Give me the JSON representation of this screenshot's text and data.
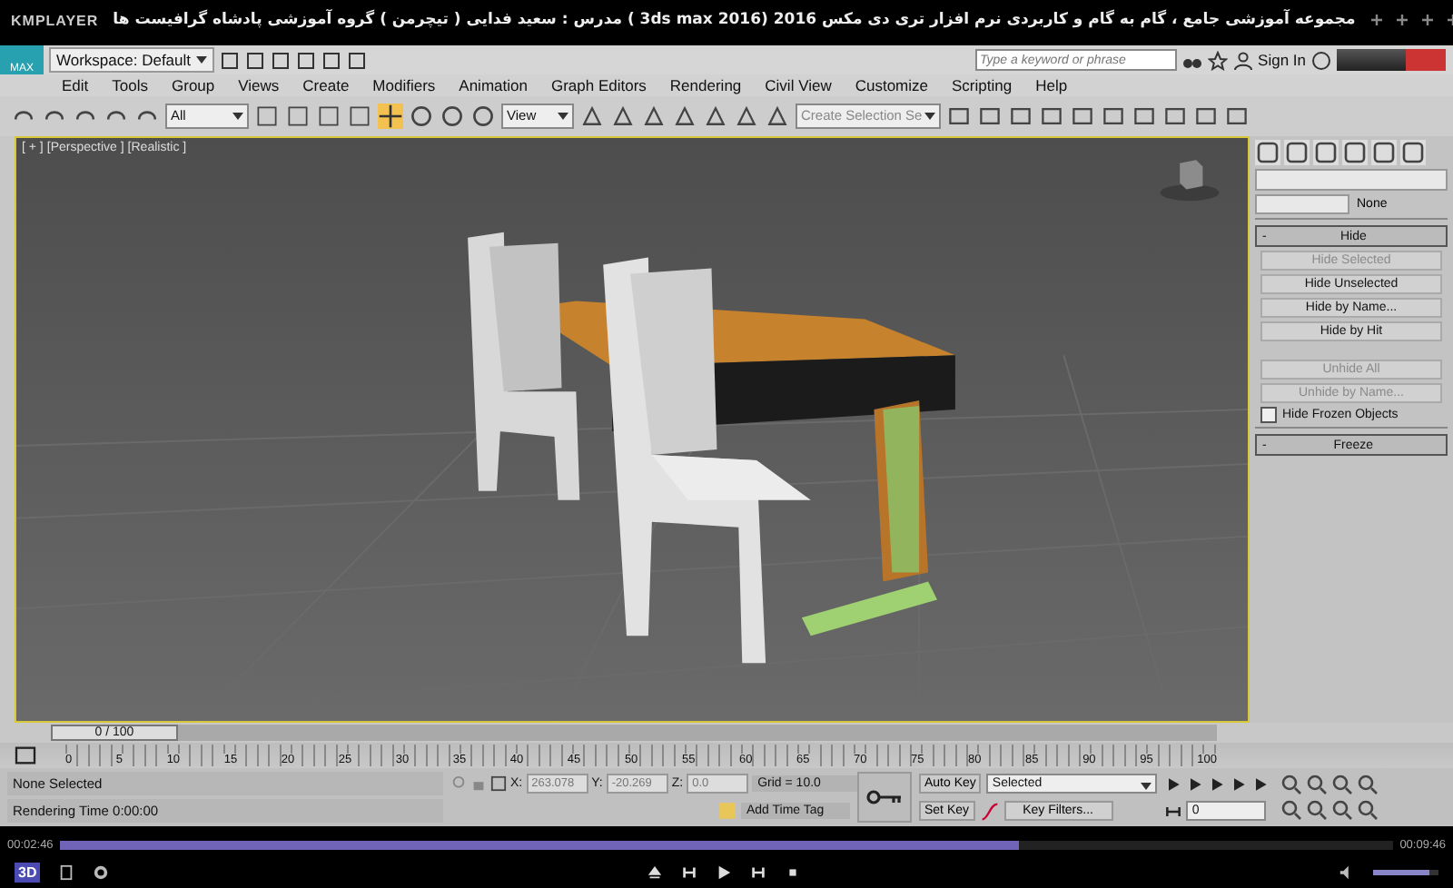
{
  "player": {
    "logo": "KMPLAYER",
    "title": "مجموعه آموزشی جامع ، گام به گام و کاربردی نرم افزار تری دی مکس 2016 (3ds max 2016 )  مدرس : سعید فدایی ( تیچرمن ) گروه آموزشی پادشاه گرافیست ها",
    "time_elapsed": "00:02:46",
    "time_total": "00:09:46",
    "progress": {
      "level": 0.72
    },
    "volume": {
      "level": 0.85
    },
    "mode_button": "3D"
  },
  "app": {
    "logo": "MAX",
    "workspace": "Workspace: Default",
    "search": {
      "placeholder": "Type a keyword or phrase"
    },
    "sign_in": "Sign In",
    "menu": [
      "Edit",
      "Tools",
      "Group",
      "Views",
      "Create",
      "Modifiers",
      "Animation",
      "Graph Editors",
      "Rendering",
      "Civil View",
      "Customize",
      "Scripting",
      "Help"
    ],
    "toolbar": {
      "selection_filter": "All",
      "reference_coord": "View",
      "selection_set": "Create Selection Se"
    },
    "viewport": {
      "labels": [
        "[ + ]",
        "[Perspective ]",
        "[Realistic ]"
      ]
    },
    "command_panel": {
      "name_button": "None",
      "rollouts": [
        {
          "title": "Hide",
          "sign": "-",
          "buttons": [
            {
              "label": "Hide Selected",
              "disabled": true
            },
            {
              "label": "Hide Unselected",
              "disabled": false
            },
            {
              "label": "Hide by Name...",
              "disabled": false
            },
            {
              "label": "Hide by Hit",
              "disabled": false
            }
          ],
          "more_buttons": [
            {
              "label": "Unhide All",
              "disabled": true
            },
            {
              "label": "Unhide by Name...",
              "disabled": true
            }
          ],
          "checkbox": {
            "label": "Hide Frozen Objects",
            "checked": false
          }
        },
        {
          "title": "Freeze",
          "sign": "-"
        }
      ]
    },
    "time_slider": {
      "label": "0 / 100",
      "level": 0
    },
    "track_ticks": [
      "0",
      "5",
      "10",
      "15",
      "20",
      "25",
      "30",
      "35",
      "40",
      "45",
      "50",
      "55",
      "60",
      "65",
      "70",
      "75",
      "80",
      "85",
      "90",
      "95",
      "100"
    ],
    "status": {
      "selection": "None Selected",
      "prompt": "Rendering Time  0:00:00",
      "coords": [
        {
          "label": "X:",
          "value": "263.078"
        },
        {
          "label": "Y:",
          "value": "-20.269"
        },
        {
          "label": "Z:",
          "value": "0.0"
        }
      ],
      "grid": "Grid = 10.0",
      "time_tag": "Add Time Tag",
      "auto_key": "Auto Key",
      "key_mode": "Selected",
      "set_key": "Set Key",
      "key_filters": "Key Filters...",
      "frame": "0"
    }
  }
}
